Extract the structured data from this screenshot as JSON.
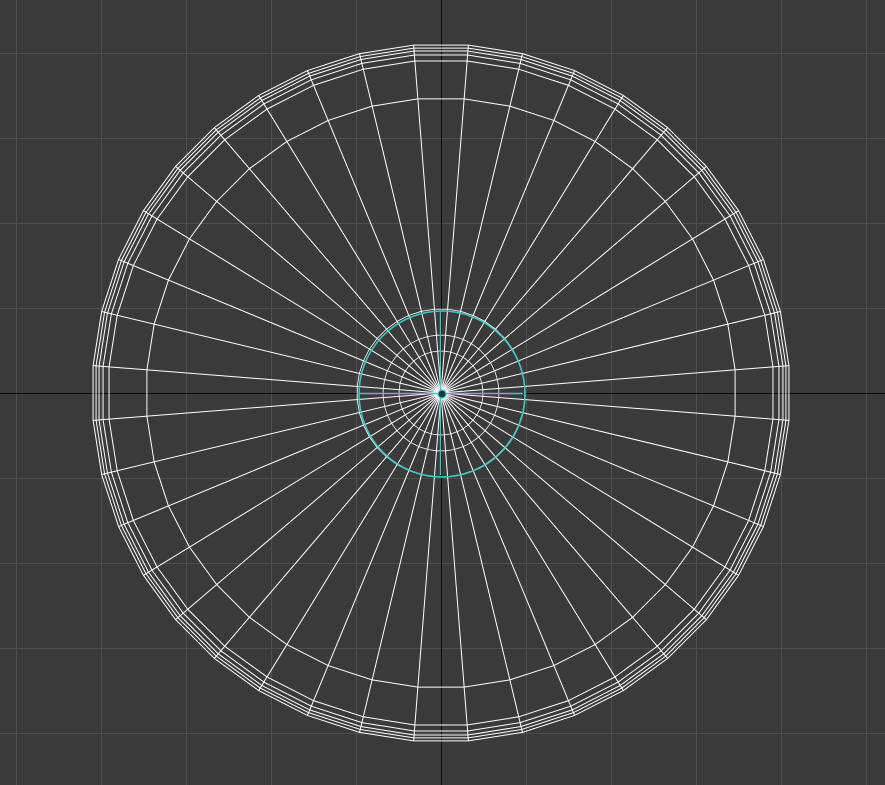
{
  "viewport": {
    "view": "top",
    "shading": "wireframe",
    "object": "cylinder",
    "radial_segments": 40,
    "ring_count": 7,
    "grid_visible": true
  },
  "colors": {
    "background": "#3a3a3a",
    "grid": "#4e4e4e",
    "world_axes": "#0a0a0a",
    "wireframe": "#ffffff",
    "selection": "#3fc7c0"
  }
}
